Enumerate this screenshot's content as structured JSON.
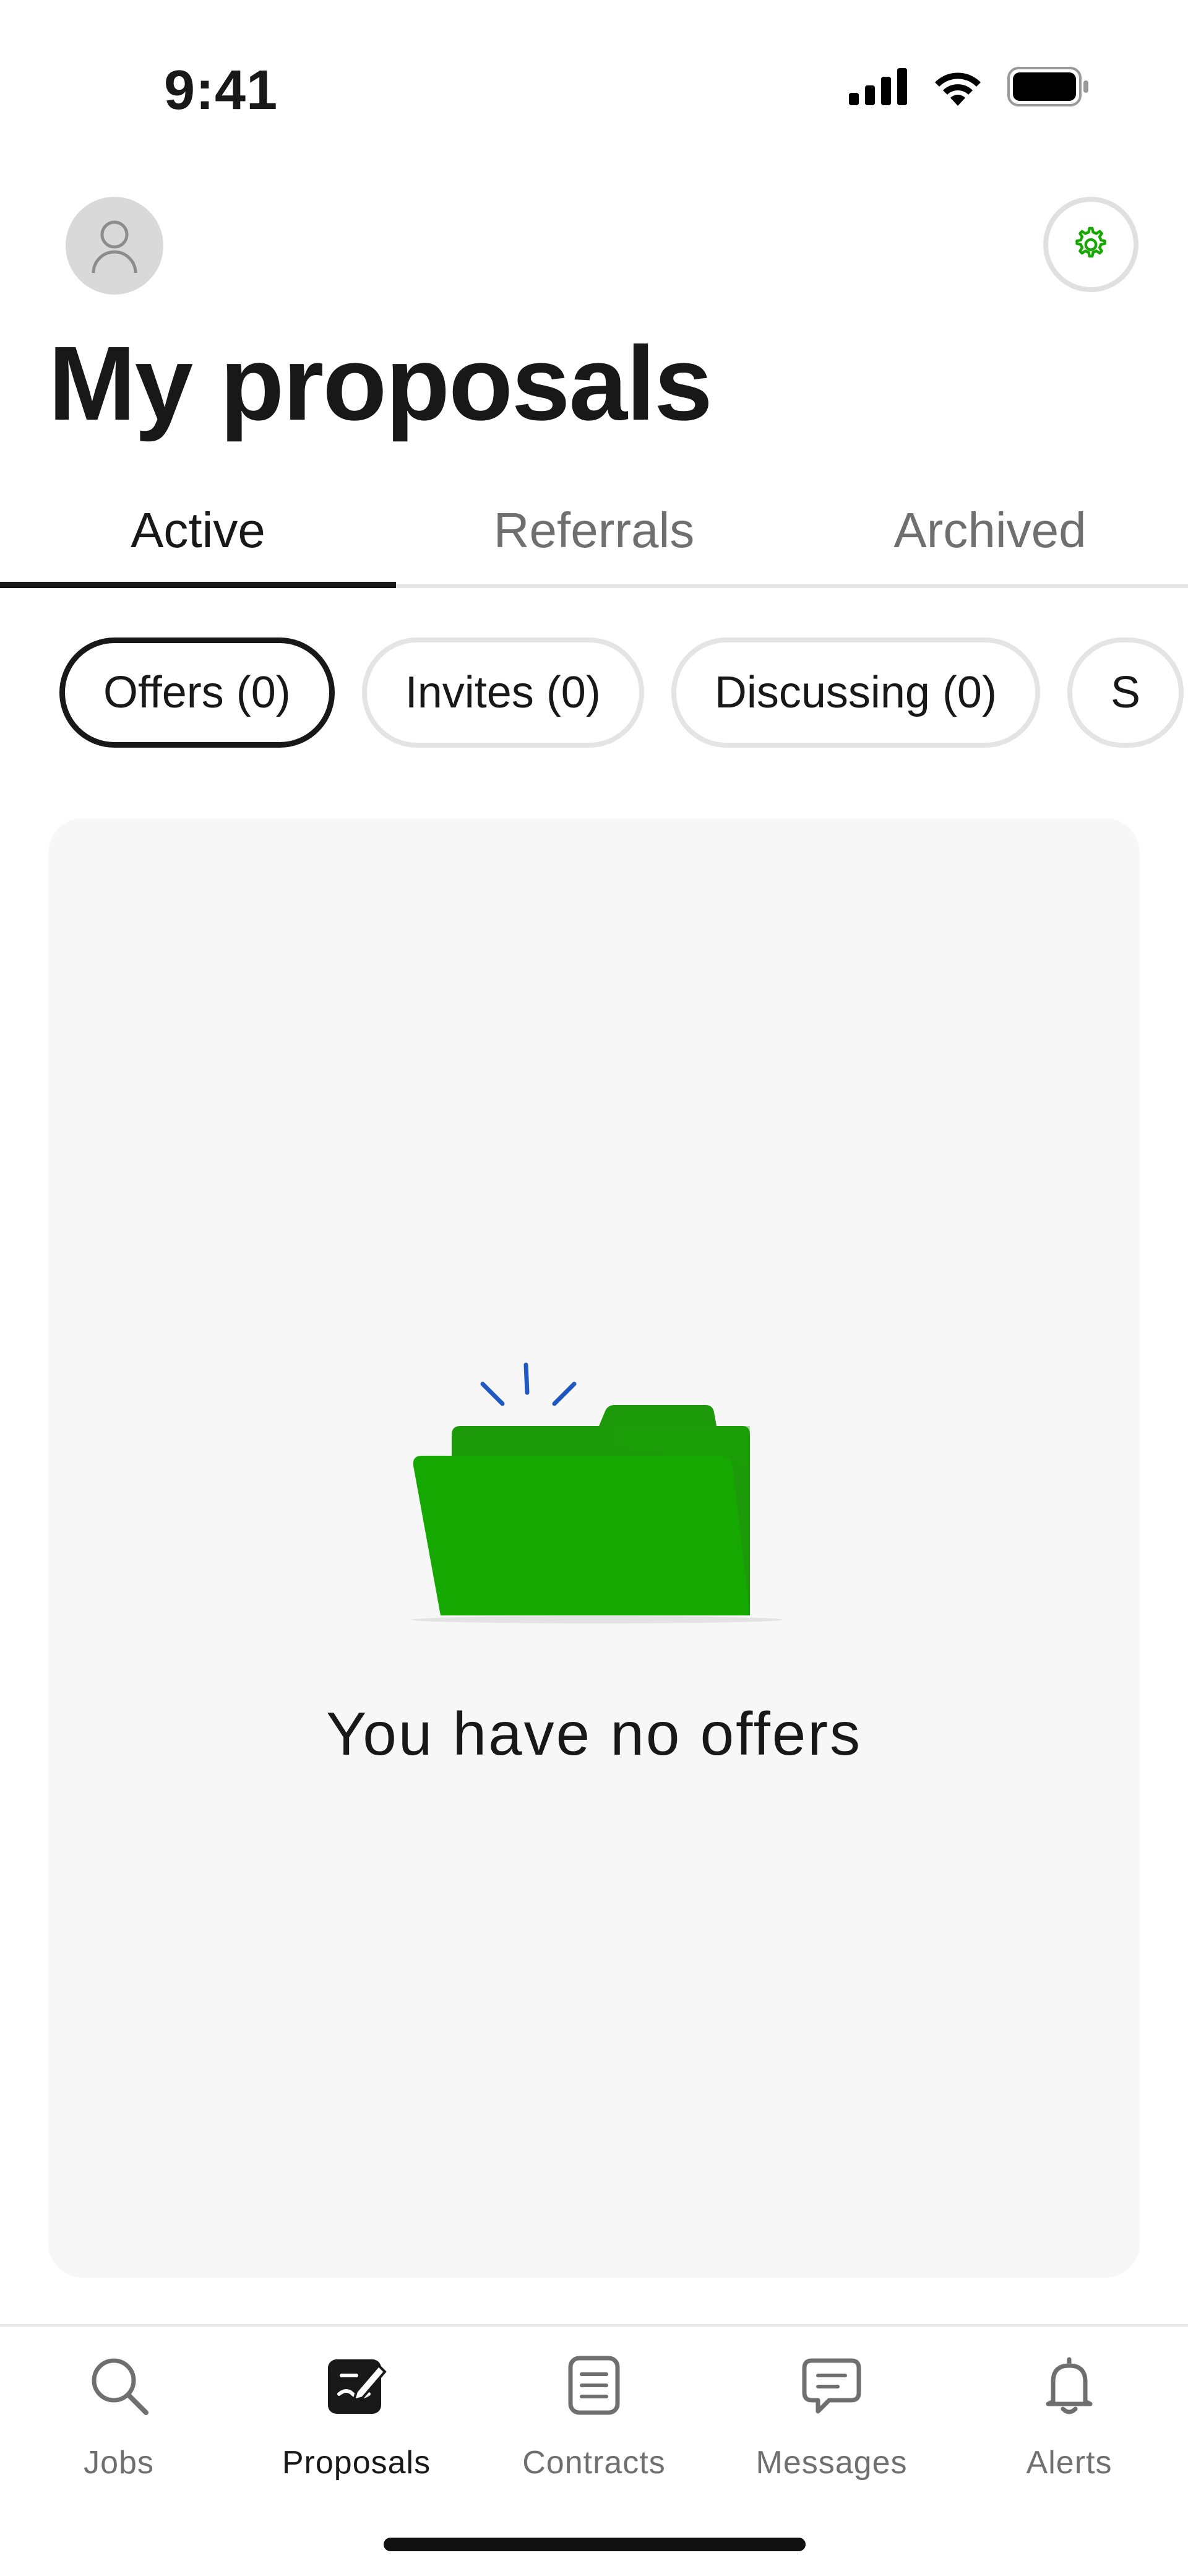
{
  "status_bar": {
    "time": "9:41"
  },
  "header": {
    "title": "My proposals"
  },
  "tabs": [
    {
      "label": "Active",
      "active": true
    },
    {
      "label": "Referrals",
      "active": false
    },
    {
      "label": "Archived",
      "active": false
    }
  ],
  "filters": [
    {
      "label": "Offers (0)",
      "selected": true
    },
    {
      "label": "Invites (0)",
      "selected": false
    },
    {
      "label": "Discussing (0)",
      "selected": false
    },
    {
      "label": "S",
      "selected": false
    }
  ],
  "empty_state": {
    "message": "You have no offers"
  },
  "bottom_nav": [
    {
      "label": "Jobs",
      "icon": "search-icon",
      "active": false
    },
    {
      "label": "Proposals",
      "icon": "proposal-pen-icon",
      "active": true
    },
    {
      "label": "Contracts",
      "icon": "contract-document-icon",
      "active": false
    },
    {
      "label": "Messages",
      "icon": "chat-bubble-icon",
      "active": false
    },
    {
      "label": "Alerts",
      "icon": "bell-icon",
      "active": false
    }
  ],
  "colors": {
    "brand_green": "#14a800",
    "text_primary": "#181818",
    "text_secondary": "#6f6f6f",
    "card_bg": "#f7f7f7",
    "spark_blue": "#1f57c3"
  }
}
